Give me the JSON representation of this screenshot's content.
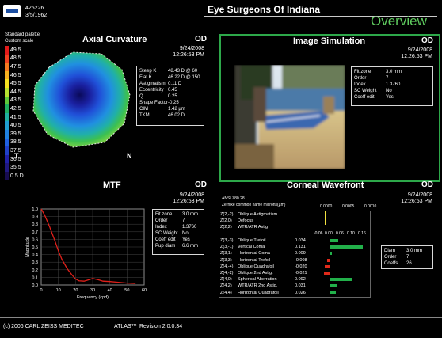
{
  "header": {
    "patient_id": "425226",
    "dob": "3/5/1962",
    "clinic": "Eye Surgeons Of Indiana",
    "view": "Overview"
  },
  "colors": {
    "accent_green": "#2da84a",
    "view_label": "#5fcc5f",
    "curve_red": "#e0201a",
    "bar_green": "#22b04a",
    "bar_red": "#e02a1a"
  },
  "axial": {
    "palette_line1": "Standard palette",
    "palette_line2": "Custom scale",
    "title": "Axial Curvature",
    "eye": "OD",
    "date": "9/24/2008",
    "time": "12:26:53 PM",
    "legend": [
      {
        "v": "49.5",
        "c": "#e21a1a"
      },
      {
        "v": "48.5",
        "c": "#f04020"
      },
      {
        "v": "47.5",
        "c": "#f57a20"
      },
      {
        "v": "46.5",
        "c": "#f5b020"
      },
      {
        "v": "45.5",
        "c": "#f3e020"
      },
      {
        "v": "44.5",
        "c": "#b6e030"
      },
      {
        "v": "43.5",
        "c": "#5ec83a"
      },
      {
        "v": "42.5",
        "c": "#20b060"
      },
      {
        "v": "41.5",
        "c": "#20b0a0"
      },
      {
        "v": "40.5",
        "c": "#20a0d0"
      },
      {
        "v": "39.5",
        "c": "#2080e0"
      },
      {
        "v": "38.5",
        "c": "#2060e0"
      },
      {
        "v": "37.5",
        "c": "#2040c8"
      },
      {
        "v": "36.5",
        "c": "#2020a8"
      },
      {
        "v": "35.5",
        "c": "#201880"
      },
      {
        "v": "0.5 D",
        "c": "#180c50"
      }
    ],
    "t_label": "T",
    "n_label": "N",
    "stats": [
      {
        "k": "Steep K",
        "v": "48.43 D @ 60"
      },
      {
        "k": "Flat K",
        "v": "46.22 D @ 150"
      },
      {
        "k": "Astigmatism",
        "v": "0.11 D"
      },
      {
        "k": "Eccentricity",
        "v": "0.45"
      },
      {
        "k": "Q",
        "v": "0.25"
      },
      {
        "k": "Shape Factor",
        "v": "-0.25"
      },
      {
        "k": "CIM",
        "v": "1.42 µm"
      },
      {
        "k": "TKM",
        "v": "46.02 D"
      }
    ]
  },
  "image_sim": {
    "title": "Image Simulation",
    "eye": "OD",
    "date": "9/24/2008",
    "time": "12:26:53 PM",
    "params": [
      {
        "k": "Fit zone",
        "v": "3.0 mm"
      },
      {
        "k": "Order",
        "v": "7"
      },
      {
        "k": "Index",
        "v": "1.3760"
      },
      {
        "k": "SC Weight",
        "v": "No"
      },
      {
        "k": "Coeff edit",
        "v": "Yes"
      }
    ]
  },
  "mtf": {
    "title": "MTF",
    "eye": "OD",
    "date": "9/24/2008",
    "time": "12:26:53 PM",
    "ylabel": "Magnitude",
    "xlabel": "Frequency (cpd)",
    "params": [
      {
        "k": "Fit zone",
        "v": "3.0 mm"
      },
      {
        "k": "Order",
        "v": "7"
      },
      {
        "k": "Index",
        "v": "1.3760"
      },
      {
        "k": "SC Weight",
        "v": "No"
      },
      {
        "k": "Coeff edit",
        "v": "Yes"
      },
      {
        "k": "Pup diam",
        "v": "6.6 mm"
      }
    ]
  },
  "wavefront": {
    "title": "Corneal Wavefront",
    "eye": "OD",
    "date": "9/24/2008",
    "time": "12:26:53 PM",
    "ansi": "ANSI Z80.28",
    "col_header": "Zernike common name microns(µm)",
    "top_scale": [
      "0.0000",
      "0.0005",
      "0.0010"
    ],
    "bottom_scale": [
      "-0.06",
      "0.00",
      "0.06",
      "0.10",
      "0.16"
    ],
    "top_terms": [
      {
        "idx": "Z(2,-2)",
        "name": "Oblique Astigmatism"
      },
      {
        "idx": "Z(2,0)",
        "name": "Defocus"
      },
      {
        "idx": "Z(2,2)",
        "name": "WTR/ATR Astig"
      }
    ],
    "terms": [
      {
        "idx": "Z(3,-3)",
        "name": "Oblique Trefoil",
        "val": "0.034"
      },
      {
        "idx": "Z(3,-1)",
        "name": "Vertical Coma",
        "val": "0.131"
      },
      {
        "idx": "Z(3,1)",
        "name": "Horizontal Coma",
        "val": "0.009"
      },
      {
        "idx": "Z(3,3)",
        "name": "Horizontal Trefoil",
        "val": "-0.008"
      },
      {
        "idx": "Z(4,-4)",
        "name": "Oblique Quadrafoil",
        "val": "-0.020"
      },
      {
        "idx": "Z(4,-2)",
        "name": "Oblique 2nd Astig.",
        "val": "-0.021"
      },
      {
        "idx": "Z(4,0)",
        "name": "Spherical Aberration",
        "val": "0.092"
      },
      {
        "idx": "Z(4,2)",
        "name": "WTR/ATR 2nd Astig.",
        "val": "0.031"
      },
      {
        "idx": "Z(4,4)",
        "name": "Horizontal Quadrafoil",
        "val": "0.026"
      }
    ],
    "params": [
      {
        "k": "Diam",
        "v": "3.0 mm"
      },
      {
        "k": "Order",
        "v": "7"
      },
      {
        "k": "Coeffs.",
        "v": "26"
      }
    ]
  },
  "chart_data": {
    "type": "line",
    "title": "",
    "xlabel": "Frequency (cpd)",
    "ylabel": "Magnitude",
    "x_ticks": [
      0,
      10,
      20,
      30,
      40,
      50,
      60
    ],
    "y_ticks": [
      0.0,
      0.1,
      0.2,
      0.3,
      0.4,
      0.5,
      0.6,
      0.7,
      0.8,
      0.9,
      1.0
    ],
    "xlim": [
      0,
      60
    ],
    "ylim": [
      0,
      1
    ],
    "grid": true,
    "series": [
      {
        "x": [
          0,
          2,
          5,
          8,
          10,
          12,
          15,
          18,
          20,
          22,
          25,
          28,
          30,
          33,
          36,
          40,
          45,
          50,
          55
        ],
        "y": [
          1.0,
          0.92,
          0.76,
          0.58,
          0.45,
          0.34,
          0.22,
          0.13,
          0.08,
          0.055,
          0.05,
          0.07,
          0.085,
          0.07,
          0.05,
          0.045,
          0.035,
          0.025,
          0.02
        ]
      }
    ]
  },
  "footer": {
    "copyright": "(c) 2006 CARL ZEISS MEDITEC",
    "product": "ATLAS™",
    "revision": "Revision  2.0.0.34"
  }
}
